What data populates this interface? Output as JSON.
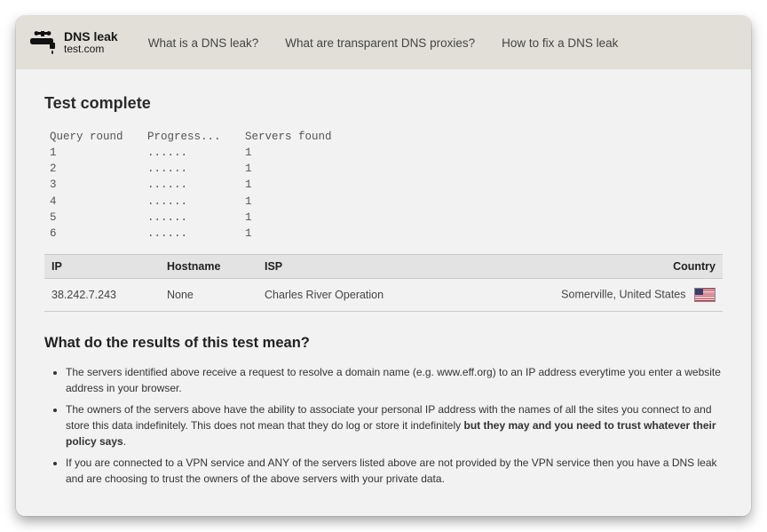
{
  "logo": {
    "line1": "DNS leak",
    "line2": "test.com"
  },
  "nav": {
    "item1": "What is a DNS leak?",
    "item2": "What are transparent DNS proxies?",
    "item3": "How to fix a DNS leak"
  },
  "title": "Test complete",
  "progress": {
    "headers": {
      "round": "Query round",
      "progress": "Progress...",
      "found": "Servers found"
    },
    "rows": [
      {
        "round": "1",
        "progress": "......",
        "found": "1"
      },
      {
        "round": "2",
        "progress": "......",
        "found": "1"
      },
      {
        "round": "3",
        "progress": "......",
        "found": "1"
      },
      {
        "round": "4",
        "progress": "......",
        "found": "1"
      },
      {
        "round": "5",
        "progress": "......",
        "found": "1"
      },
      {
        "round": "6",
        "progress": "......",
        "found": "1"
      }
    ]
  },
  "results": {
    "headers": {
      "ip": "IP",
      "hostname": "Hostname",
      "isp": "ISP",
      "country": "Country"
    },
    "rows": [
      {
        "ip": "38.242.7.243",
        "hostname": "None",
        "isp": "Charles River Operation",
        "country": "Somerville, United States"
      }
    ]
  },
  "meaning": {
    "heading": "What do the results of this test mean?",
    "li1": "The servers identified above receive a request to resolve a domain name (e.g. www.eff.org) to an IP address everytime you enter a website address in your browser.",
    "li2a": "The owners of the servers above have the ability to associate your personal IP address with the names of all the sites you connect to and store this data indefinitely. This does not mean that they do log or store it indefinitely ",
    "li2b": "but they may and you need to trust whatever their policy says",
    "li2c": ".",
    "li3": "If you are connected to a VPN service and ANY of the servers listed above are not provided by the VPN service then you have a DNS leak and are choosing to trust the owners of the above servers with your private data."
  }
}
